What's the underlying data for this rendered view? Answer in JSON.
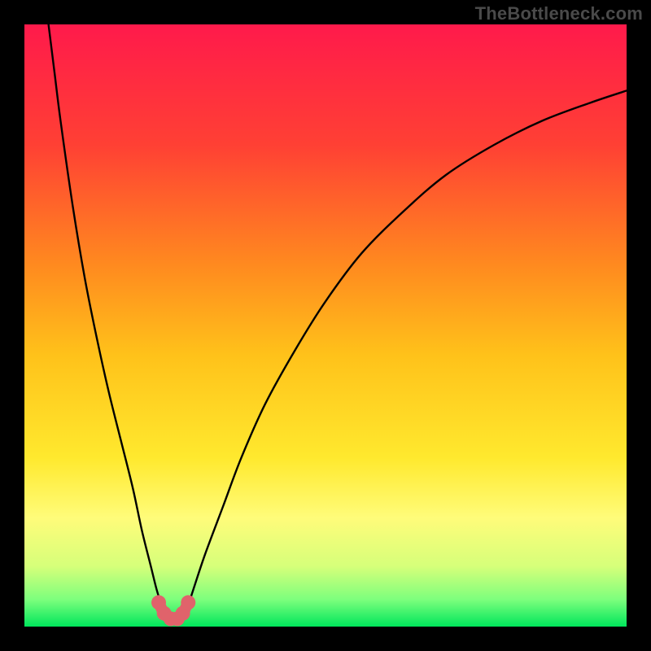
{
  "watermark": "TheBottleneck.com",
  "chart_data": {
    "type": "line",
    "title": "",
    "xlabel": "",
    "ylabel": "",
    "xlim": [
      0,
      100
    ],
    "ylim": [
      0,
      100
    ],
    "grid": false,
    "legend": false,
    "gradient_stops": [
      {
        "offset": 0.0,
        "color": "#ff1a4b"
      },
      {
        "offset": 0.2,
        "color": "#ff4034"
      },
      {
        "offset": 0.4,
        "color": "#ff8a1f"
      },
      {
        "offset": 0.55,
        "color": "#ffc21a"
      },
      {
        "offset": 0.72,
        "color": "#ffe92e"
      },
      {
        "offset": 0.82,
        "color": "#fffc7a"
      },
      {
        "offset": 0.9,
        "color": "#d6ff7a"
      },
      {
        "offset": 0.955,
        "color": "#7dff7d"
      },
      {
        "offset": 1.0,
        "color": "#00e65c"
      }
    ],
    "series": [
      {
        "name": "bottleneck-curve",
        "x": [
          4,
          5,
          6,
          8,
          10,
          12,
          14,
          16,
          18,
          19.5,
          21,
          22,
          23,
          24,
          25,
          26,
          27,
          28,
          30,
          33,
          36,
          40,
          45,
          50,
          56,
          63,
          70,
          78,
          86,
          94,
          100
        ],
        "values": [
          100,
          92,
          84,
          70,
          58,
          48,
          39,
          31,
          23,
          16,
          10,
          6,
          3,
          1.5,
          1,
          1.5,
          3,
          6,
          12,
          20,
          28,
          37,
          46,
          54,
          62,
          69,
          75,
          80,
          84,
          87,
          89
        ]
      }
    ],
    "markers": {
      "name": "minimum-region",
      "color": "#e0636b",
      "x": [
        22.3,
        23.2,
        24.3,
        25.4,
        26.3,
        27.2
      ],
      "values": [
        4.0,
        2.2,
        1.3,
        1.3,
        2.2,
        4.0
      ]
    }
  }
}
